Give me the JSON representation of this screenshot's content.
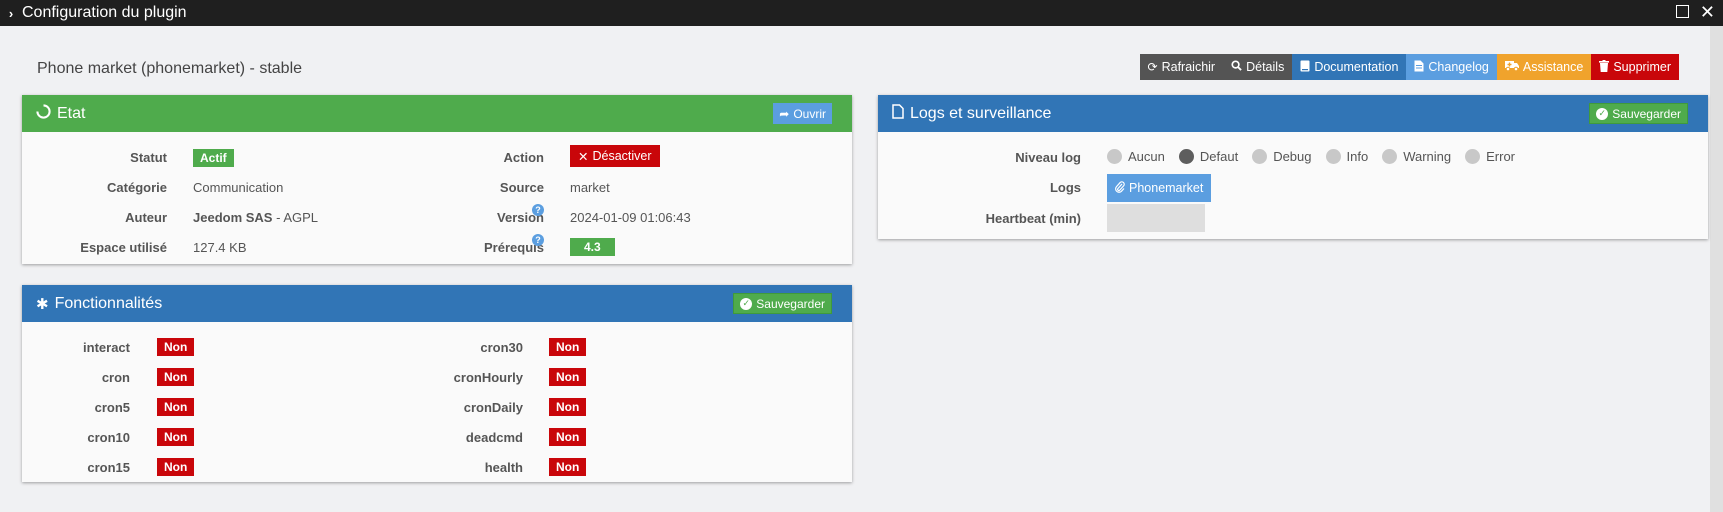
{
  "window": {
    "title": "Configuration du plugin",
    "chevron": "›",
    "close": "✕"
  },
  "plugin": {
    "title": "Phone market (phonemarket) - stable"
  },
  "toolbar": {
    "refresh": "Rafraichir",
    "details": "Détails",
    "documentation": "Documentation",
    "changelog": "Changelog",
    "assistance": "Assistance",
    "delete": "Supprimer"
  },
  "etat": {
    "title": "Etat",
    "open_btn": "Ouvrir",
    "statut_label": "Statut",
    "statut_value": "Actif",
    "categorie_label": "Catégorie",
    "categorie_value": "Communication",
    "auteur_label": "Auteur",
    "auteur_value": "Jeedom SAS",
    "auteur_license": " - AGPL",
    "espace_label": "Espace utilisé",
    "espace_value": "127.4 KB",
    "action_label": "Action",
    "action_btn": "Désactiver",
    "source_label": "Source",
    "source_value": "market",
    "version_label": "Version",
    "version_value": "2024-01-09 01:06:43",
    "prerequis_label": "Prérequis",
    "prerequis_value": "4.3",
    "help": "?"
  },
  "fonctions": {
    "title": "Fonctionnalités",
    "save_btn": "Sauvegarder",
    "left": [
      {
        "name": "interact",
        "value": "Non"
      },
      {
        "name": "cron",
        "value": "Non"
      },
      {
        "name": "cron5",
        "value": "Non"
      },
      {
        "name": "cron10",
        "value": "Non"
      },
      {
        "name": "cron15",
        "value": "Non"
      }
    ],
    "right": [
      {
        "name": "cron30",
        "value": "Non"
      },
      {
        "name": "cronHourly",
        "value": "Non"
      },
      {
        "name": "cronDaily",
        "value": "Non"
      },
      {
        "name": "deadcmd",
        "value": "Non"
      },
      {
        "name": "health",
        "value": "Non"
      }
    ]
  },
  "logs": {
    "title": "Logs et surveillance",
    "save_btn": "Sauvegarder",
    "niveau_label": "Niveau log",
    "levels": [
      "Aucun",
      "Defaut",
      "Debug",
      "Info",
      "Warning",
      "Error"
    ],
    "selected_level": "Defaut",
    "logs_label": "Logs",
    "logs_btn": "Phonemarket",
    "heartbeat_label": "Heartbeat (min)",
    "heartbeat_value": ""
  }
}
